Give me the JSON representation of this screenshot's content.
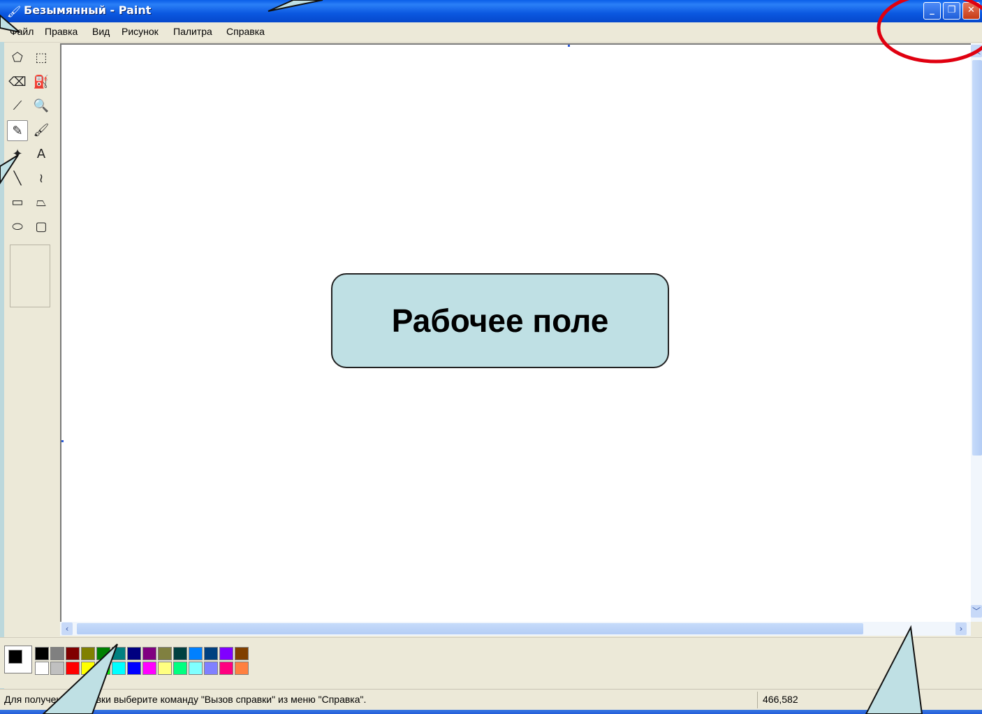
{
  "window": {
    "title": "Безымянный - Paint",
    "minimize_glyph": "_",
    "maximize_glyph": "❐",
    "close_glyph": "✕"
  },
  "menu": [
    "Файл",
    "Правка",
    "Вид",
    "Рисунок",
    "Палитра",
    "Справка"
  ],
  "tools": [
    {
      "name": "free-select-icon",
      "glyph": "⬠"
    },
    {
      "name": "rect-select-icon",
      "glyph": "⬚"
    },
    {
      "name": "eraser-icon",
      "glyph": "⌫"
    },
    {
      "name": "fill-bucket-icon",
      "glyph": "⛽"
    },
    {
      "name": "color-picker-icon",
      "glyph": "⟋"
    },
    {
      "name": "magnifier-icon",
      "glyph": "🔍"
    },
    {
      "name": "pencil-icon",
      "glyph": "✎",
      "selected": true
    },
    {
      "name": "brush-icon",
      "glyph": "🖌"
    },
    {
      "name": "airbrush-icon",
      "glyph": "✦"
    },
    {
      "name": "text-tool-icon",
      "glyph": "A"
    },
    {
      "name": "line-icon",
      "glyph": "╲"
    },
    {
      "name": "curve-icon",
      "glyph": "≀"
    },
    {
      "name": "rectangle-icon",
      "glyph": "▭"
    },
    {
      "name": "polygon-icon",
      "glyph": "⏢"
    },
    {
      "name": "ellipse-icon",
      "glyph": "⬭"
    },
    {
      "name": "rounded-rect-icon",
      "glyph": "▢"
    }
  ],
  "palette": {
    "foreground": "#000000",
    "background": "#ffffff",
    "row1": [
      "#000000",
      "#808080",
      "#800000",
      "#808000",
      "#008000",
      "#008080",
      "#000080",
      "#800080",
      "#808040",
      "#004040",
      "#0080ff",
      "#004080",
      "#8000ff",
      "#804000"
    ],
    "row2": [
      "#ffffff",
      "#c0c0c0",
      "#ff0000",
      "#ffff00",
      "#00ff00",
      "#00ffff",
      "#0000ff",
      "#ff00ff",
      "#ffff80",
      "#00ff80",
      "#80ffff",
      "#8080ff",
      "#ff0080",
      "#ff8040"
    ]
  },
  "status": {
    "text": "Для получения справки выберите команду \"Вызов справки\" из меню \"Справка\".",
    "coords": "466,582"
  },
  "overlay": {
    "label": "Рабочее поле"
  }
}
